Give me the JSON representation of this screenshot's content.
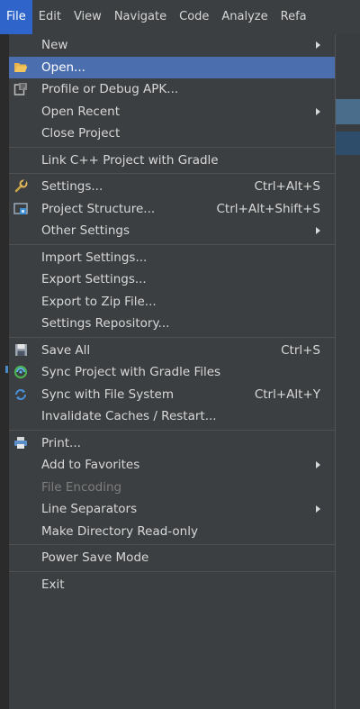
{
  "menubar": {
    "items": [
      "File",
      "Edit",
      "View",
      "Navigate",
      "Code",
      "Analyze",
      "Refa"
    ]
  },
  "file_menu": {
    "new": "New",
    "open": "Open...",
    "profile_debug_apk": "Profile or Debug APK...",
    "open_recent": "Open Recent",
    "close_project": "Close Project",
    "link_cpp": "Link C++ Project with Gradle",
    "settings": {
      "label": "Settings...",
      "shortcut": "Ctrl+Alt+S"
    },
    "project_structure": {
      "label": "Project Structure...",
      "shortcut": "Ctrl+Alt+Shift+S"
    },
    "other_settings": "Other Settings",
    "import_settings": "Import Settings...",
    "export_settings": "Export Settings...",
    "export_zip": "Export to Zip File...",
    "settings_repository": "Settings Repository...",
    "save_all": {
      "label": "Save All",
      "shortcut": "Ctrl+S"
    },
    "sync_gradle": "Sync Project with Gradle Files",
    "sync_fs": {
      "label": "Sync with File System",
      "shortcut": "Ctrl+Alt+Y"
    },
    "invalidate_caches": "Invalidate Caches / Restart...",
    "print": "Print...",
    "add_favorites": "Add to Favorites",
    "file_encoding": "File Encoding",
    "line_separators": "Line Separators",
    "make_readonly": "Make Directory Read-only",
    "power_save": "Power Save Mode",
    "exit": "Exit"
  },
  "colors": {
    "menubar_bg": "#3c3f41",
    "active_menu": "#2f65ca",
    "selected_item": "#4b6eaf",
    "text": "#d8d8d8",
    "disabled_text": "#7e7e7e"
  }
}
